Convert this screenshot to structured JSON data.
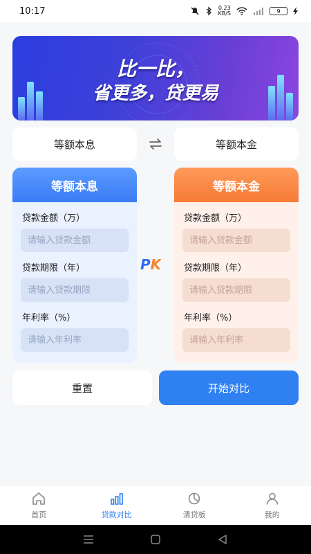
{
  "status": {
    "time": "10:17",
    "speed_value": "0.23",
    "speed_unit": "KB/S",
    "battery": "9"
  },
  "banner": {
    "line1": "比一比，",
    "line2": "省更多，贷更易"
  },
  "methods": {
    "left": "等额本息",
    "right": "等额本金"
  },
  "left_panel": {
    "title": "等额本息",
    "amount_label": "贷款金额（万）",
    "amount_placeholder": "请输入贷款金额",
    "term_label": "贷款期限（年）",
    "term_placeholder": "请输入贷款期限",
    "rate_label": "年利率（%）",
    "rate_placeholder": "请输入年利率"
  },
  "right_panel": {
    "title": "等额本金",
    "amount_label": "贷款金额（万）",
    "amount_placeholder": "请输入贷款金额",
    "term_label": "贷款期限（年）",
    "term_placeholder": "请输入贷款期限",
    "rate_label": "年利率（%）",
    "rate_placeholder": "请输入年利率"
  },
  "pk_label": "PK",
  "buttons": {
    "reset": "重置",
    "start": "开始对比"
  },
  "tabs": [
    {
      "label": "首页",
      "icon": "home-icon",
      "active": false
    },
    {
      "label": "贷款对比",
      "icon": "bar-chart-icon",
      "active": true
    },
    {
      "label": "清贷板",
      "icon": "board-icon",
      "active": false
    },
    {
      "label": "我的",
      "icon": "user-icon",
      "active": false
    }
  ],
  "colors": {
    "primary": "#2f80f0",
    "orange": "#f67a36"
  }
}
